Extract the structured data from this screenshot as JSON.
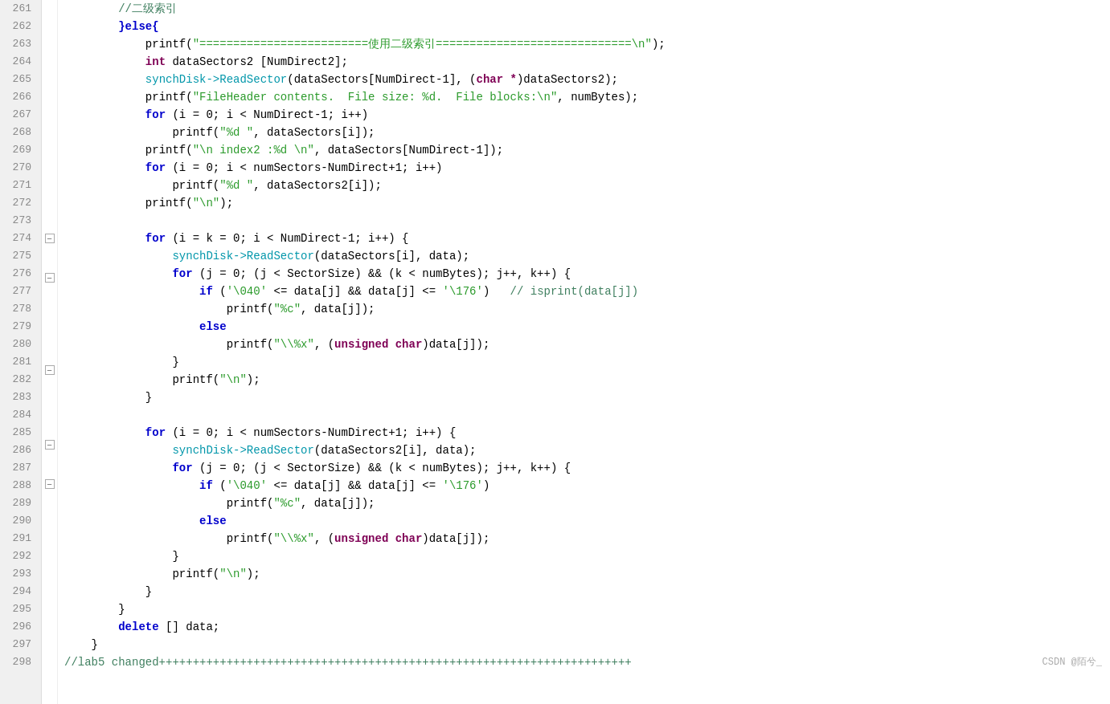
{
  "editor": {
    "background": "#ffffff",
    "lineNumberBg": "#f0f0f0"
  },
  "lines": [
    {
      "num": "261",
      "fold": false,
      "indent": 2,
      "tokens": [
        {
          "t": "comment",
          "v": "//二级索引"
        }
      ]
    },
    {
      "num": "262",
      "fold": false,
      "indent": 2,
      "tokens": [
        {
          "t": "kw",
          "v": "}else{"
        }
      ]
    },
    {
      "num": "263",
      "fold": false,
      "indent": 3,
      "tokens": [
        {
          "t": "fn",
          "v": "printf("
        },
        {
          "t": "str",
          "v": "\"=========================使用二级索引=============================\\n\""
        },
        {
          "t": "fn",
          "v": ");"
        }
      ]
    },
    {
      "num": "264",
      "fold": false,
      "indent": 3,
      "tokens": [
        {
          "t": "kw2",
          "v": "int"
        },
        {
          "t": "fn",
          "v": " dataSectors2 [NumDirect2];"
        }
      ]
    },
    {
      "num": "265",
      "fold": false,
      "indent": 3,
      "tokens": [
        {
          "t": "cyan-fn",
          "v": "synchDisk->ReadSector"
        },
        {
          "t": "fn",
          "v": "(dataSectors[NumDirect-1], ("
        },
        {
          "t": "kw2",
          "v": "char *"
        },
        {
          "t": "fn",
          "v": ")dataSectors2);"
        }
      ]
    },
    {
      "num": "266",
      "fold": false,
      "indent": 3,
      "tokens": [
        {
          "t": "fn",
          "v": "printf("
        },
        {
          "t": "str",
          "v": "\"FileHeader contents.  File size: %d.  File blocks:\\n\""
        },
        {
          "t": "fn",
          "v": ", numBytes);"
        }
      ]
    },
    {
      "num": "267",
      "fold": false,
      "indent": 3,
      "tokens": [
        {
          "t": "kw",
          "v": "for"
        },
        {
          "t": "fn",
          "v": " (i = 0; i < NumDirect-1; i++)"
        }
      ]
    },
    {
      "num": "268",
      "fold": false,
      "indent": 4,
      "tokens": [
        {
          "t": "fn",
          "v": "printf("
        },
        {
          "t": "str",
          "v": "\"%d \""
        },
        {
          "t": "fn",
          "v": ", dataSectors[i]);"
        }
      ]
    },
    {
      "num": "269",
      "fold": false,
      "indent": 3,
      "tokens": [
        {
          "t": "fn",
          "v": "printf("
        },
        {
          "t": "str",
          "v": "\"\\n index2 :%d \\n\""
        },
        {
          "t": "fn",
          "v": ", dataSectors[NumDirect-1]);"
        }
      ]
    },
    {
      "num": "270",
      "fold": false,
      "indent": 3,
      "tokens": [
        {
          "t": "kw",
          "v": "for"
        },
        {
          "t": "fn",
          "v": " (i = 0; i < numSectors-NumDirect+1; i++)"
        }
      ]
    },
    {
      "num": "271",
      "fold": false,
      "indent": 4,
      "tokens": [
        {
          "t": "fn",
          "v": "printf("
        },
        {
          "t": "str",
          "v": "\"%d \""
        },
        {
          "t": "fn",
          "v": ", dataSectors2[i]);"
        }
      ]
    },
    {
      "num": "272",
      "fold": false,
      "indent": 3,
      "tokens": [
        {
          "t": "fn",
          "v": "printf("
        },
        {
          "t": "str",
          "v": "\"\\n\""
        },
        {
          "t": "fn",
          "v": ");"
        }
      ]
    },
    {
      "num": "273",
      "fold": false,
      "indent": 0,
      "tokens": []
    },
    {
      "num": "274",
      "fold": true,
      "indent": 3,
      "tokens": [
        {
          "t": "kw",
          "v": "for"
        },
        {
          "t": "fn",
          "v": " (i = k = 0; i < NumDirect-1; i++) {"
        }
      ]
    },
    {
      "num": "275",
      "fold": false,
      "indent": 4,
      "tokens": [
        {
          "t": "cyan-fn",
          "v": "synchDisk->ReadSector"
        },
        {
          "t": "fn",
          "v": "(dataSectors[i], data);"
        }
      ]
    },
    {
      "num": "276",
      "fold": true,
      "indent": 4,
      "tokens": [
        {
          "t": "kw",
          "v": "for"
        },
        {
          "t": "fn",
          "v": " (j = 0; (j < SectorSize) && (k < numBytes); j++, k++) {"
        }
      ]
    },
    {
      "num": "277",
      "fold": false,
      "indent": 5,
      "tokens": [
        {
          "t": "kw",
          "v": "if"
        },
        {
          "t": "fn",
          "v": " ("
        },
        {
          "t": "str",
          "v": "'\\040'"
        },
        {
          "t": "fn",
          "v": " <= data[j] && data[j] <= "
        },
        {
          "t": "str",
          "v": "'\\176'"
        },
        {
          "t": "fn",
          "v": ")   "
        },
        {
          "t": "comment",
          "v": "// isprint(data[j])"
        }
      ]
    },
    {
      "num": "278",
      "fold": false,
      "indent": 6,
      "tokens": [
        {
          "t": "fn",
          "v": "printf("
        },
        {
          "t": "str",
          "v": "\"%c\""
        },
        {
          "t": "fn",
          "v": ", data[j]);"
        }
      ]
    },
    {
      "num": "279",
      "fold": false,
      "indent": 5,
      "tokens": [
        {
          "t": "kw",
          "v": "else"
        }
      ]
    },
    {
      "num": "280",
      "fold": false,
      "indent": 6,
      "tokens": [
        {
          "t": "fn",
          "v": "printf("
        },
        {
          "t": "str",
          "v": "\"\\\\%x\""
        },
        {
          "t": "fn",
          "v": ", ("
        },
        {
          "t": "kw2",
          "v": "unsigned char"
        },
        {
          "t": "fn",
          "v": ")data[j]);"
        }
      ]
    },
    {
      "num": "281",
      "fold": true,
      "indent": 4,
      "tokens": [
        {
          "t": "fn",
          "v": "}"
        }
      ]
    },
    {
      "num": "282",
      "fold": false,
      "indent": 4,
      "tokens": [
        {
          "t": "fn",
          "v": "printf("
        },
        {
          "t": "str",
          "v": "\"\\n\""
        },
        {
          "t": "fn",
          "v": ");"
        }
      ]
    },
    {
      "num": "283",
      "fold": false,
      "indent": 3,
      "tokens": [
        {
          "t": "fn",
          "v": "}"
        }
      ]
    },
    {
      "num": "284",
      "fold": false,
      "indent": 0,
      "tokens": []
    },
    {
      "num": "285",
      "fold": true,
      "indent": 3,
      "tokens": [
        {
          "t": "kw",
          "v": "for"
        },
        {
          "t": "fn",
          "v": " (i = 0; i < numSectors-NumDirect+1; i++) {"
        }
      ]
    },
    {
      "num": "286",
      "fold": false,
      "indent": 4,
      "tokens": [
        {
          "t": "cyan-fn",
          "v": "synchDisk->ReadSector"
        },
        {
          "t": "fn",
          "v": "(dataSectors2[i], data);"
        }
      ]
    },
    {
      "num": "287",
      "fold": true,
      "indent": 4,
      "tokens": [
        {
          "t": "kw",
          "v": "for"
        },
        {
          "t": "fn",
          "v": " (j = 0; (j < SectorSize) && (k < numBytes); j++, k++) {"
        }
      ]
    },
    {
      "num": "288",
      "fold": false,
      "indent": 5,
      "tokens": [
        {
          "t": "kw",
          "v": "if"
        },
        {
          "t": "fn",
          "v": " ("
        },
        {
          "t": "str",
          "v": "'\\040'"
        },
        {
          "t": "fn",
          "v": " <= data[j] && data[j] <= "
        },
        {
          "t": "str",
          "v": "'\\176'"
        },
        {
          "t": "fn",
          "v": ")"
        }
      ]
    },
    {
      "num": "289",
      "fold": false,
      "indent": 6,
      "tokens": [
        {
          "t": "fn",
          "v": "printf("
        },
        {
          "t": "str",
          "v": "\"%c\""
        },
        {
          "t": "fn",
          "v": ", data[j]);"
        }
      ]
    },
    {
      "num": "290",
      "fold": false,
      "indent": 5,
      "tokens": [
        {
          "t": "kw",
          "v": "else"
        }
      ]
    },
    {
      "num": "291",
      "fold": false,
      "indent": 6,
      "tokens": [
        {
          "t": "fn",
          "v": "printf("
        },
        {
          "t": "str",
          "v": "\"\\\\%x\""
        },
        {
          "t": "fn",
          "v": ", ("
        },
        {
          "t": "kw2",
          "v": "unsigned char"
        },
        {
          "t": "fn",
          "v": ")data[j]);"
        }
      ]
    },
    {
      "num": "292",
      "fold": false,
      "indent": 4,
      "tokens": [
        {
          "t": "fn",
          "v": "}"
        }
      ]
    },
    {
      "num": "293",
      "fold": false,
      "indent": 4,
      "tokens": [
        {
          "t": "fn",
          "v": "printf("
        },
        {
          "t": "str",
          "v": "\"\\n\""
        },
        {
          "t": "fn",
          "v": ");"
        }
      ]
    },
    {
      "num": "294",
      "fold": false,
      "indent": 3,
      "tokens": [
        {
          "t": "fn",
          "v": "}"
        }
      ]
    },
    {
      "num": "295",
      "fold": false,
      "indent": 2,
      "tokens": [
        {
          "t": "fn",
          "v": "}"
        }
      ]
    },
    {
      "num": "296",
      "fold": false,
      "indent": 2,
      "tokens": [
        {
          "t": "kw",
          "v": "delete"
        },
        {
          "t": "fn",
          "v": " [] data;"
        }
      ]
    },
    {
      "num": "297",
      "fold": false,
      "indent": 1,
      "tokens": [
        {
          "t": "fn",
          "v": "}"
        }
      ]
    },
    {
      "num": "298",
      "fold": false,
      "indent": 0,
      "tokens": [
        {
          "t": "comment",
          "v": "//lab5 changed++++++++++++++++++++++++++++++++++++++++++++++++++++++++++++++++++++++"
        }
      ]
    }
  ],
  "watermark": "CSDN @陌兮_",
  "bottom_comment": "//lab5 changed++++++++++++++++++++++++++++++++++++++++++++++++++++++++++++++++++++++",
  "fold_lines": [
    "274",
    "276",
    "281",
    "285",
    "287"
  ],
  "indent_size": 4
}
